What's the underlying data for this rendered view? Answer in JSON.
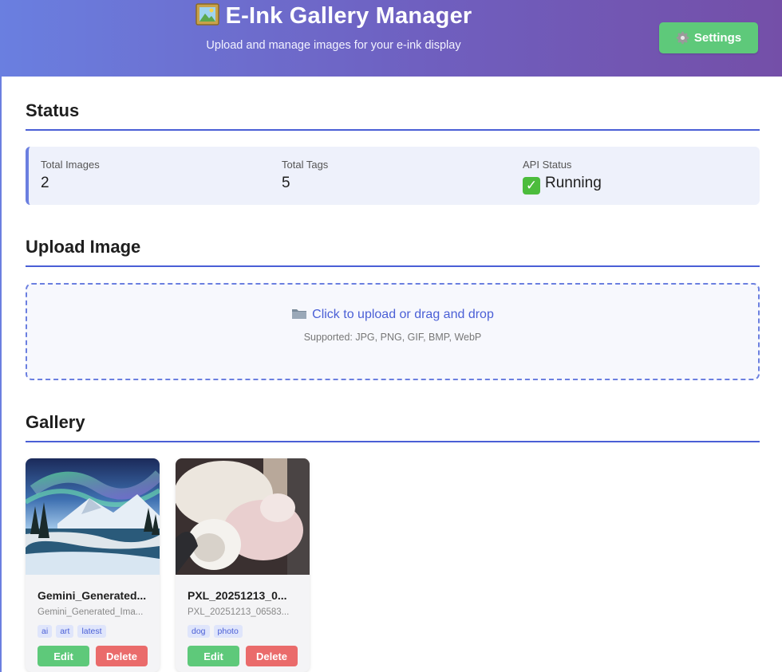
{
  "header": {
    "title": "E-Ink Gallery Manager",
    "logo_icon": "framed-picture-icon",
    "subtitle": "Upload and manage images for your e-ink display",
    "settings_label": "Settings",
    "settings_icon": "gear-icon"
  },
  "status": {
    "heading": "Status",
    "total_images_label": "Total Images",
    "total_images_value": "2",
    "total_tags_label": "Total Tags",
    "total_tags_value": "5",
    "api_status_label": "API Status",
    "api_status_value": "Running",
    "api_status_icon": "check-mark-icon"
  },
  "upload": {
    "heading": "Upload Image",
    "prompt": "Click to upload or drag and drop",
    "prompt_icon": "folder-icon",
    "supported": "Supported: JPG, PNG, GIF, BMP, WebP"
  },
  "gallery": {
    "heading": "Gallery",
    "items": [
      {
        "name": "Gemini_Generated...",
        "filename": "Gemini_Generated_Ima...",
        "tags": [
          "ai",
          "art",
          "latest"
        ],
        "edit_label": "Edit",
        "delete_label": "Delete"
      },
      {
        "name": "PXL_20251213_0...",
        "filename": "PXL_20251213_06583...",
        "tags": [
          "dog",
          "photo"
        ],
        "edit_label": "Edit",
        "delete_label": "Delete"
      }
    ]
  },
  "colors": {
    "header_gradient_start": "#6a7fe0",
    "header_gradient_end": "#744fa8",
    "accent": "#4a5fd6",
    "success": "#5ec97a",
    "danger": "#ea6b6b"
  }
}
